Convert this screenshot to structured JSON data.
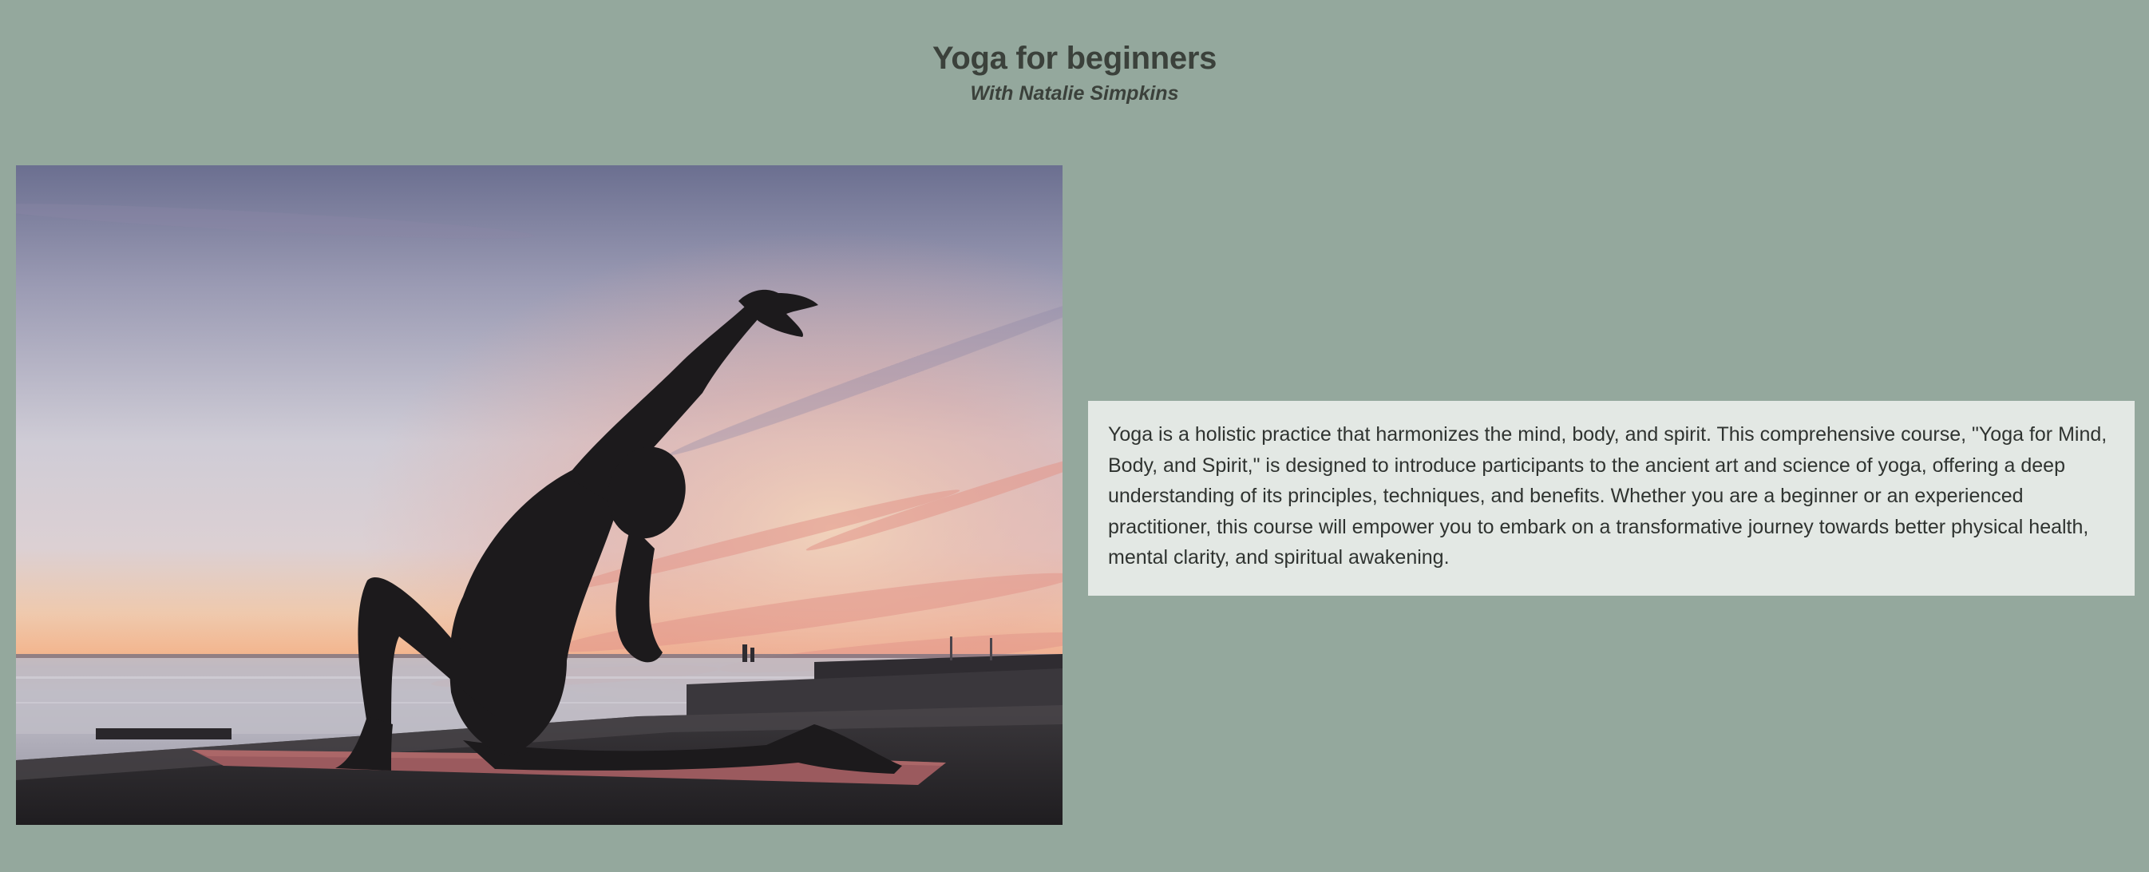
{
  "header": {
    "title": "Yoga for beginners",
    "subtitle": "With Natalie Simpkins"
  },
  "hero_image": {
    "alt": "",
    "icon": "sunset-yoga-silhouette-photo",
    "colors": {
      "sky_top": "#6f7393",
      "sky_mid": "#c9c7d3",
      "horizon_glow": "#f3c9a7",
      "cloud_pink": "#e59b8f",
      "water": "#b9b9c4",
      "ground": "#2c292c",
      "mat": "#9c5e60",
      "silhouette": "#1d1b1d"
    }
  },
  "description": {
    "text": "Yoga is a holistic practice that harmonizes the mind, body, and spirit. This comprehensive course, \"Yoga for Mind, Body, and Spirit,\" is designed to introduce participants to the ancient art and science of yoga, offering a deep understanding of its principles, techniques, and benefits. Whether you are a beginner or an experienced practitioner, this course will empower you to embark on a transformative journey towards better physical health, mental clarity, and spiritual awakening."
  },
  "theme": {
    "background": "#94a89d",
    "panel": "#e3e8e4",
    "text": "#3b413b"
  }
}
